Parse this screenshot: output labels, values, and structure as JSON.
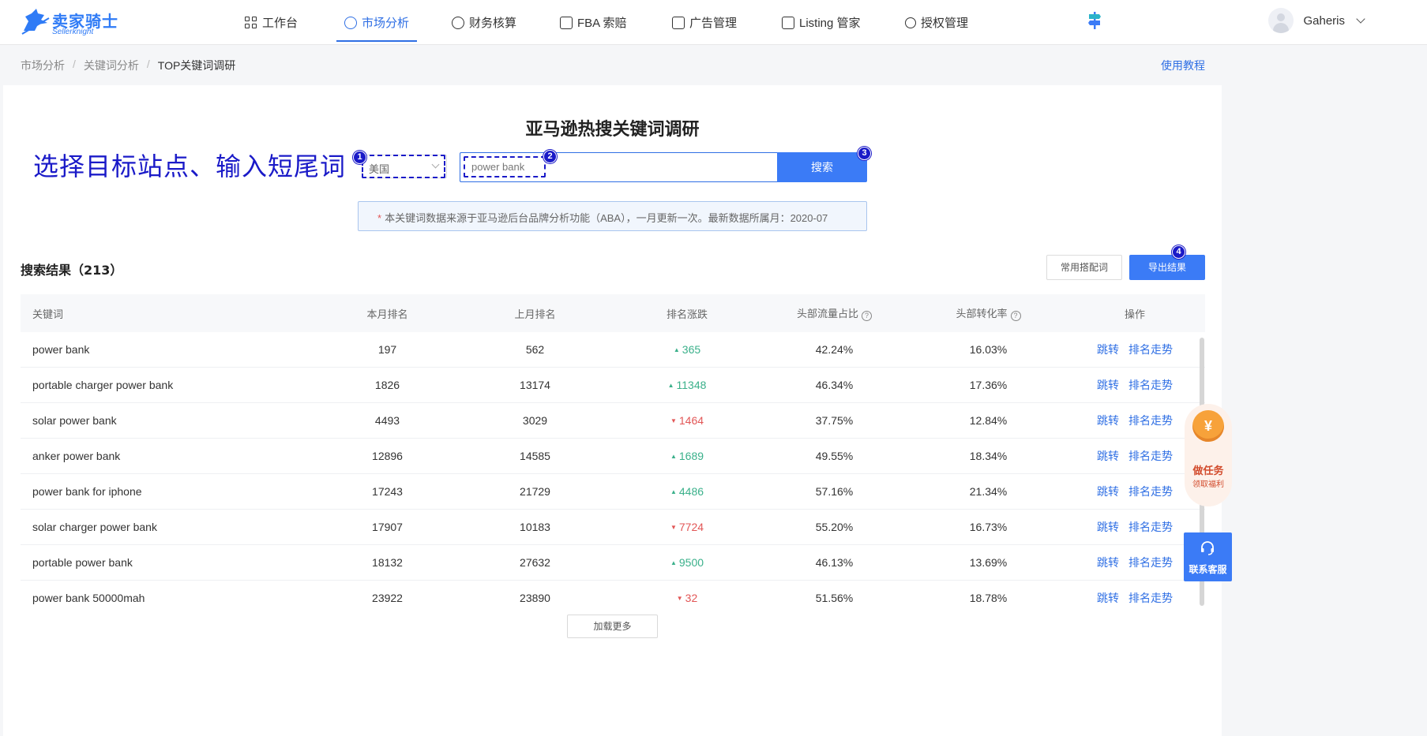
{
  "brand": {
    "name_cn": "卖家骑士",
    "name_en": "Sellerknight",
    "color": "#2f7bf6"
  },
  "nav": [
    {
      "label": "工作台",
      "icon": "grid-icon",
      "active": false
    },
    {
      "label": "市场分析",
      "icon": "target-icon",
      "active": true
    },
    {
      "label": "财务核算",
      "icon": "dollar-icon",
      "active": false
    },
    {
      "label": "FBA 索赔",
      "icon": "fba-claim-icon",
      "active": false
    },
    {
      "label": "广告管理",
      "icon": "ad-icon",
      "active": false
    },
    {
      "label": "Listing 管家",
      "icon": "listing-icon",
      "active": false
    },
    {
      "label": "授权管理",
      "icon": "auth-icon",
      "active": false
    }
  ],
  "user": {
    "name": "Gaheris"
  },
  "breadcrumb": [
    "市场分析",
    "关键词分析",
    "TOP关键词调研"
  ],
  "tutorial": "使用教程",
  "title": "亚马逊热搜关键词调研",
  "annotation": {
    "hint": "选择目标站点、输入短尾词",
    "badges": [
      "1",
      "2",
      "3",
      "4"
    ],
    "color": "#1a1ac8"
  },
  "search": {
    "site": "美国",
    "query": "power bank",
    "button": "搜索"
  },
  "notice": {
    "star": "*",
    "text": "本关键词数据来源于亚马逊后台品牌分析功能（ABA），一月更新一次。最新数据所属月：2020-07"
  },
  "results": {
    "title": "搜索结果（213）",
    "common_btn": "常用搭配词",
    "export_btn": "导出结果",
    "load_more": "加载更多"
  },
  "table": {
    "headers": [
      "关键词",
      "本月排名",
      "上月排名",
      "排名涨跌",
      "头部流量占比",
      "头部转化率",
      "操作"
    ],
    "help_mark": "?",
    "rows": [
      {
        "kw": "power bank",
        "cur": "197",
        "prev": "562",
        "change": "365",
        "dir": "up",
        "traffic": "42.24%",
        "conv": "16.03%"
      },
      {
        "kw": "portable charger power bank",
        "cur": "1826",
        "prev": "13174",
        "change": "11348",
        "dir": "up",
        "traffic": "46.34%",
        "conv": "17.36%"
      },
      {
        "kw": "solar power bank",
        "cur": "4493",
        "prev": "3029",
        "change": "1464",
        "dir": "down",
        "traffic": "37.75%",
        "conv": "12.84%"
      },
      {
        "kw": "anker power bank",
        "cur": "12896",
        "prev": "14585",
        "change": "1689",
        "dir": "up",
        "traffic": "49.55%",
        "conv": "18.34%"
      },
      {
        "kw": "power bank for iphone",
        "cur": "17243",
        "prev": "21729",
        "change": "4486",
        "dir": "up",
        "traffic": "57.16%",
        "conv": "21.34%"
      },
      {
        "kw": "solar charger power bank",
        "cur": "17907",
        "prev": "10183",
        "change": "7724",
        "dir": "down",
        "traffic": "55.20%",
        "conv": "16.73%"
      },
      {
        "kw": "portable power bank",
        "cur": "18132",
        "prev": "27632",
        "change": "9500",
        "dir": "up",
        "traffic": "46.13%",
        "conv": "13.69%"
      },
      {
        "kw": "power bank 50000mah",
        "cur": "23922",
        "prev": "23890",
        "change": "32",
        "dir": "down",
        "traffic": "51.56%",
        "conv": "18.78%"
      }
    ],
    "op_jump": "跳转",
    "op_trend": "排名走势"
  },
  "float": {
    "task_coin": "¥",
    "task_title": "做任务",
    "task_sub": "领取福利",
    "support": "联系客服"
  }
}
